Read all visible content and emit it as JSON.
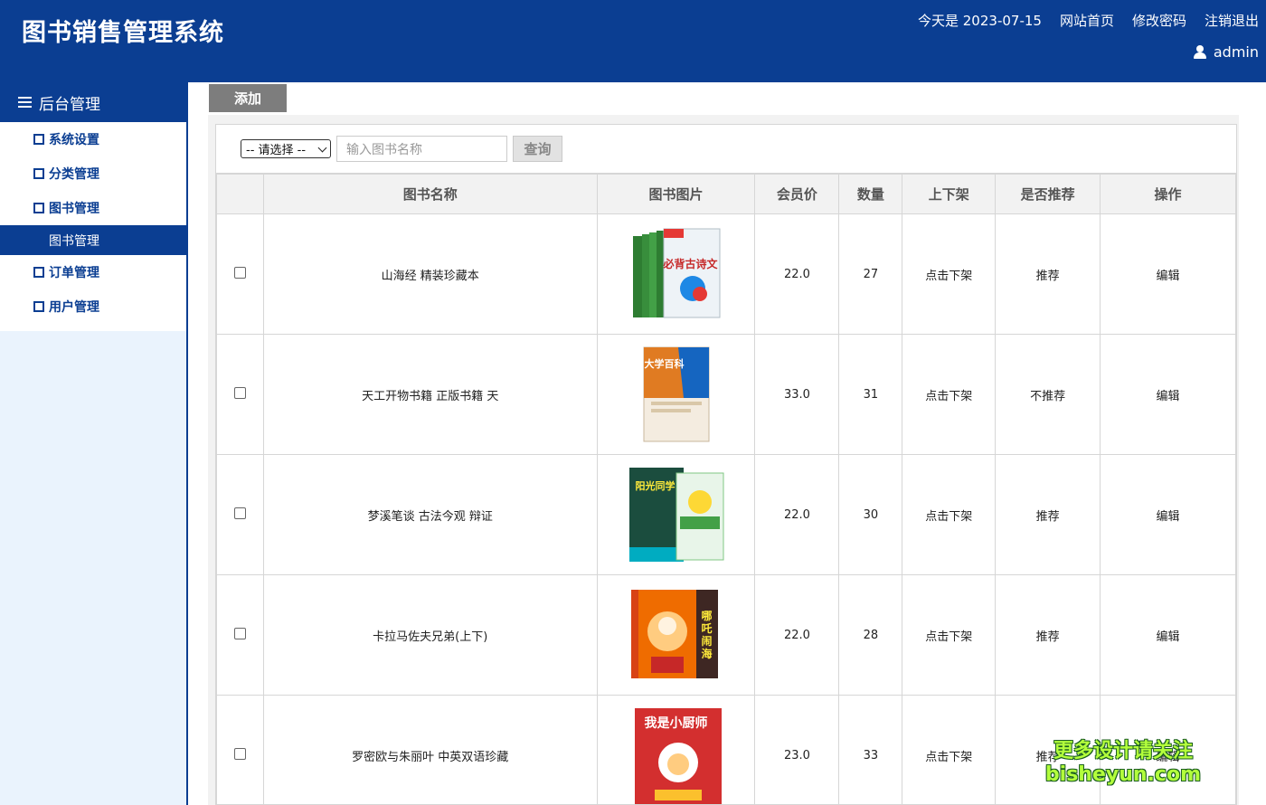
{
  "header": {
    "title": "图书销售管理系统",
    "date_text": "今天是 2023-07-15",
    "links": [
      "网站首页",
      "修改密码",
      "注销退出"
    ],
    "username": "admin"
  },
  "sidebar": {
    "head": "后台管理",
    "items": [
      {
        "label": "系统设置"
      },
      {
        "label": "分类管理"
      },
      {
        "label": "图书管理",
        "sub": "图书管理"
      },
      {
        "label": "订单管理"
      },
      {
        "label": "用户管理"
      }
    ]
  },
  "toolbar": {
    "add_label": "添加"
  },
  "search": {
    "select_value": "-- 请选择 --",
    "input_placeholder": "输入图书名称",
    "query_label": "查询"
  },
  "table": {
    "columns": [
      "",
      "图书名称",
      "图书图片",
      "会员价",
      "数量",
      "上下架",
      "是否推荐",
      "操作"
    ],
    "rows": [
      {
        "name": "山海经 精装珍藏本",
        "price": "22.0",
        "qty": "27",
        "shelf": "点击下架",
        "recommend": "推荐",
        "action": "编辑"
      },
      {
        "name": "天工开物书籍 正版书籍 天",
        "price": "33.0",
        "qty": "31",
        "shelf": "点击下架",
        "recommend": "不推荐",
        "action": "编辑"
      },
      {
        "name": "梦溪笔谈 古法今观 辩证",
        "price": "22.0",
        "qty": "30",
        "shelf": "点击下架",
        "recommend": "推荐",
        "action": "编辑"
      },
      {
        "name": "卡拉马佐夫兄弟(上下)",
        "price": "22.0",
        "qty": "28",
        "shelf": "点击下架",
        "recommend": "推荐",
        "action": "编辑"
      },
      {
        "name": "罗密欧与朱丽叶 中英双语珍藏",
        "price": "23.0",
        "qty": "33",
        "shelf": "点击下架",
        "recommend": "推荐",
        "action": "编辑"
      }
    ],
    "cover_texts": [
      "必背古诗文",
      "大学百科",
      "阳光同学",
      "哪吒闹海",
      "我是小厨师"
    ]
  },
  "watermark": {
    "line1": "更多设计请关注",
    "line2": "bisheyun.com"
  },
  "colors": {
    "brand": "#0b3e92",
    "sidebar_bg": "#eaf3fd"
  }
}
